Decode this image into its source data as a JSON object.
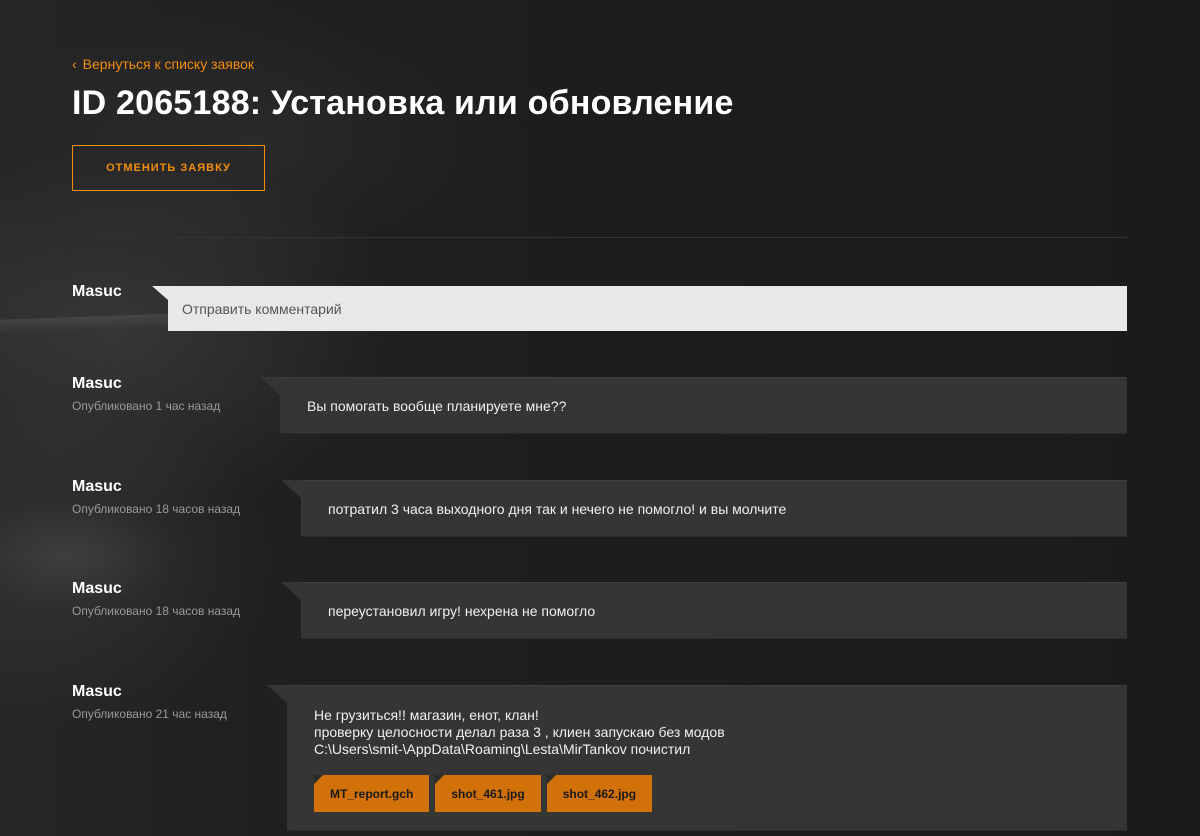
{
  "header": {
    "back_link": "Вернуться к списку заявок",
    "title": "ID 2065188: Установка или обновление",
    "cancel_button": "Отменить заявку"
  },
  "composer": {
    "author": "Masuc",
    "placeholder": "Отправить комментарий"
  },
  "comments": [
    {
      "author": "Masuc",
      "published": "Опубликовано 1 час назад",
      "lines": [
        "Вы помогать вообще планируете мне??"
      ],
      "attachments": []
    },
    {
      "author": "Masuc",
      "published": "Опубликовано 18 часов назад",
      "lines": [
        "потратил 3 часа выходного дня так и нечего не помогло! и вы молчите"
      ],
      "attachments": []
    },
    {
      "author": "Masuc",
      "published": "Опубликовано 18 часов назад",
      "lines": [
        "переустановил игру! нехрена не помогло"
      ],
      "attachments": []
    },
    {
      "author": "Masuc",
      "published": "Опубликовано 21 час назад",
      "lines": [
        "Не грузиться!! магазин, енот, клан!",
        "проверку целосности делал раза 3 , клиен запускаю без модов",
        "C:\\Users\\smit-\\AppData\\Roaming\\Lesta\\MirTankov почистил"
      ],
      "attachments": [
        "MT_report.gch",
        "shot_461.jpg",
        "shot_462.jpg"
      ]
    }
  ],
  "colors": {
    "accent": "#f28c0c",
    "attachment": "#d2700a",
    "bubble": "#353535",
    "background": "#1c1c1c"
  }
}
